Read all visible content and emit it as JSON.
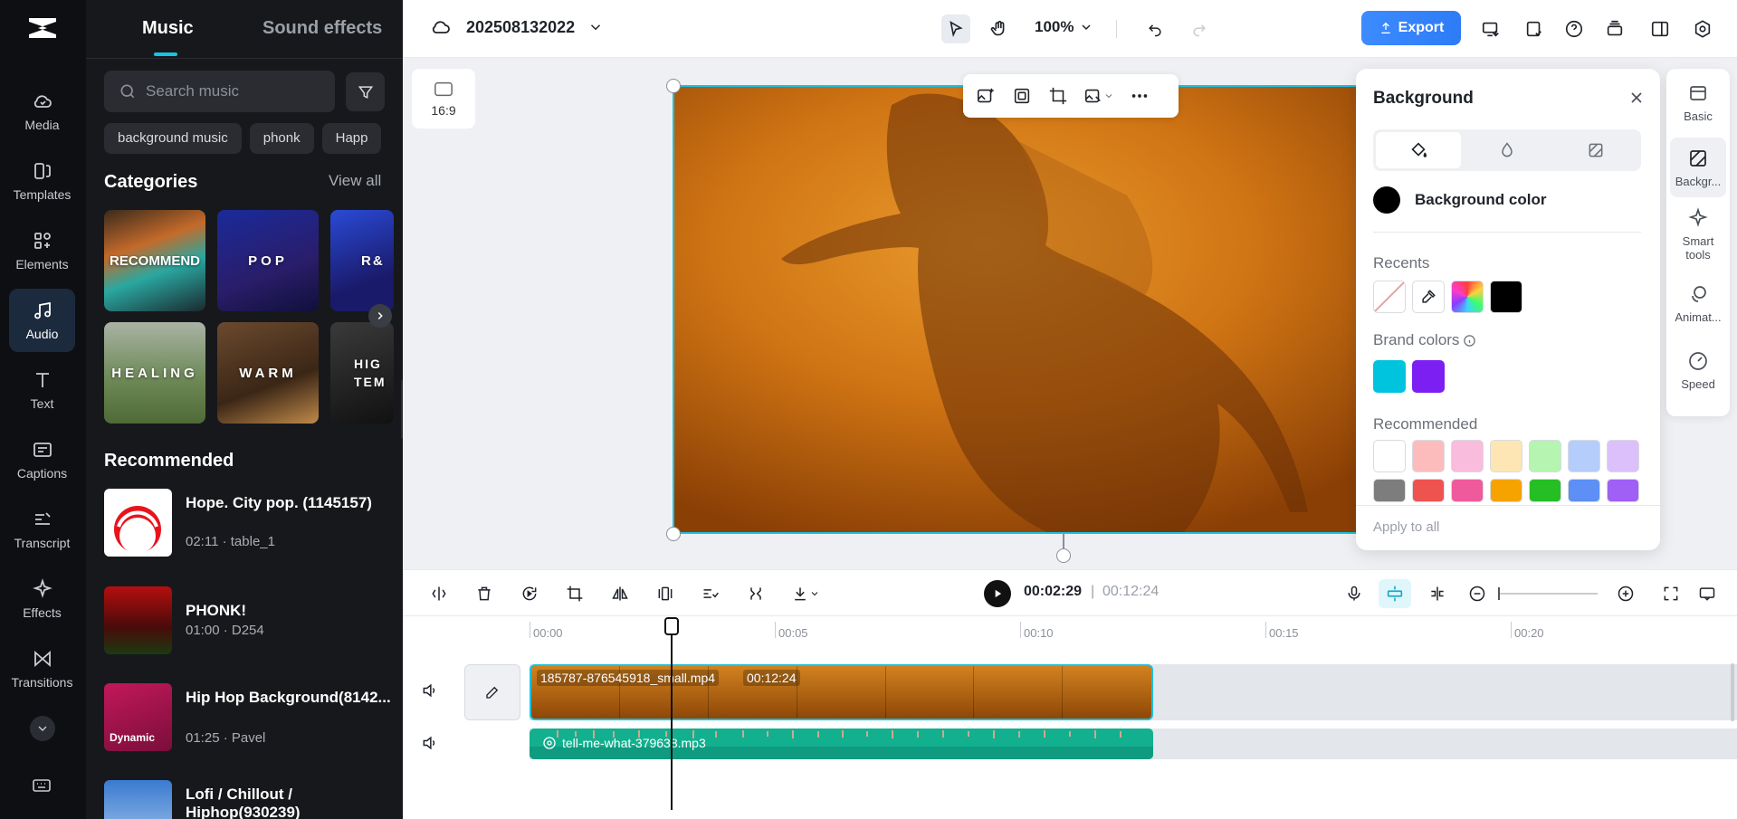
{
  "rail": {
    "items": [
      {
        "label": "Media",
        "icon": "cloud-media-icon"
      },
      {
        "label": "Templates",
        "icon": "templates-icon"
      },
      {
        "label": "Elements",
        "icon": "elements-icon"
      },
      {
        "label": "Audio",
        "icon": "music-note-icon"
      },
      {
        "label": "Text",
        "icon": "text-t-icon"
      },
      {
        "label": "Captions",
        "icon": "captions-icon"
      },
      {
        "label": "Transcript",
        "icon": "transcript-icon"
      },
      {
        "label": "Effects",
        "icon": "sparkle-effects-icon"
      },
      {
        "label": "Transitions",
        "icon": "bowtie-transition-icon"
      }
    ],
    "active": "Audio"
  },
  "panel": {
    "tabs": [
      "Music",
      "Sound effects"
    ],
    "search_placeholder": "Search music",
    "chips": [
      "background music",
      "phonk",
      "Happ"
    ],
    "categories_title": "Categories",
    "view_all": "View all",
    "categories": [
      "RECOMMEND",
      "POP",
      "R&",
      "HEALING",
      "WARM",
      "HIG TEM"
    ],
    "recommended_title": "Recommended",
    "tracks": [
      {
        "name": "Hope. City pop. (1145157)",
        "meta": "02:11 · table_1"
      },
      {
        "name": "PHONK!",
        "meta": "01:00 · D254"
      },
      {
        "name": "Hip Hop Background(8142...",
        "meta": "01:25 · Pavel",
        "thumb_text": "Dynamic"
      },
      {
        "name": "Lofi / Chillout / Hiphop(930239)",
        "meta": ""
      }
    ]
  },
  "topbar": {
    "project_name": "202508132022",
    "zoom": "100%",
    "export_label": "Export"
  },
  "stage": {
    "ratio_label": "16:9"
  },
  "bgpanel": {
    "title": "Background",
    "bg_color_label": "Background color",
    "recents_label": "Recents",
    "brand_label": "Brand colors",
    "recommended_label": "Recommended",
    "apply_all": "Apply to all",
    "brand_colors": [
      "#00c4de",
      "#7b1ff2"
    ],
    "recommended_colors": [
      "#ffffff",
      "#fdbcbc",
      "#f9bcdc",
      "#fde6b4",
      "#b5f5b1",
      "#b5cdfb",
      "#dcc0fb",
      "#7d7d7d",
      "#ef5350",
      "#ef5a9c",
      "#f6a300",
      "#25be25",
      "#5d8ff5",
      "#a05ff5"
    ]
  },
  "proprail": {
    "items": [
      "Basic",
      "Backgr...",
      "Smart tools",
      "Animat...",
      "Speed"
    ],
    "active": "Backgr..."
  },
  "timeline": {
    "current_time": "00:02:29",
    "separator": "|",
    "total_time": "00:12:24",
    "ticks": [
      "00:00",
      "00:05",
      "00:10",
      "00:15",
      "00:20"
    ],
    "video_clip": {
      "name": "185787-876545918_small.mp4",
      "duration": "00:12:24"
    },
    "audio_clip": {
      "name": "tell-me-what-379638.mp3"
    }
  }
}
